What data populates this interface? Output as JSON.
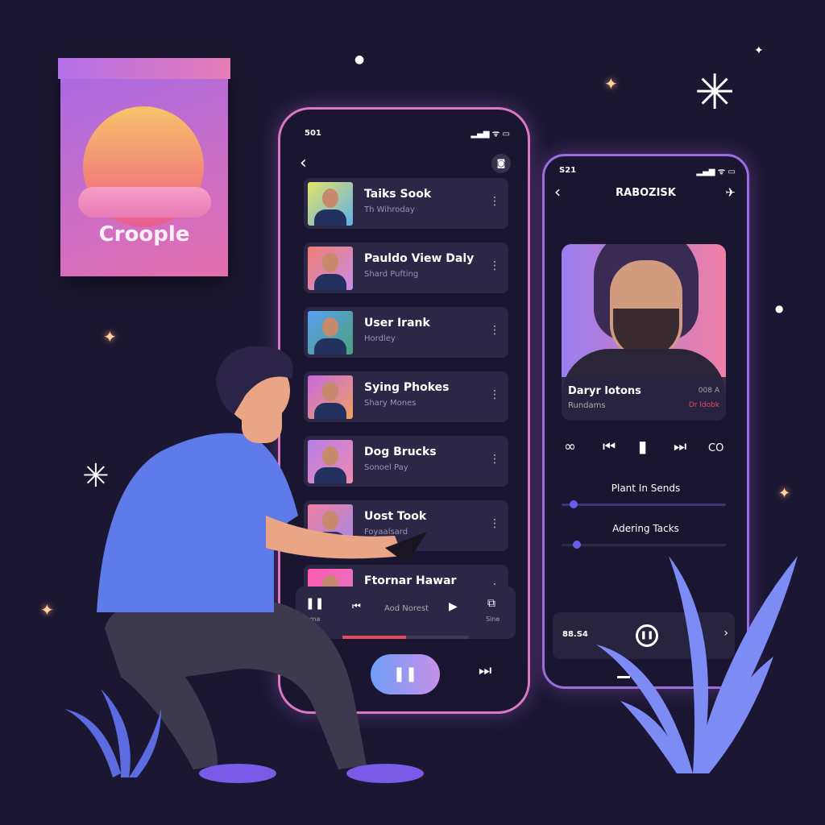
{
  "brand_card": {
    "label": "Croople"
  },
  "phone_list": {
    "status_time": "501",
    "rows": [
      {
        "title": "Taiks Sook",
        "subtitle": "Th Wihroday"
      },
      {
        "title": "Pauldo View Daly",
        "subtitle": "Shard Pufting"
      },
      {
        "title": "User Irank",
        "subtitle": "Hordley"
      },
      {
        "title": "Sying Phokes",
        "subtitle": "Shary Mones"
      },
      {
        "title": "Dog Brucks",
        "subtitle": "Sonoel Pay"
      },
      {
        "title": "Uost Took",
        "subtitle": "Foyaalsard"
      },
      {
        "title": "Ftornar Hawar",
        "subtitle": ""
      }
    ],
    "mini_player": {
      "left_label": "Fhma",
      "track": "Aod Norest",
      "right_label": "Sine",
      "progress": 0.5
    }
  },
  "phone_player": {
    "status_time": "S21",
    "title": "RABOZISK",
    "artist": "Daryr lotons",
    "album": "Rundams",
    "meta_right": "008 A",
    "meta_link": "Dr ldobk",
    "left_ctrl": "∞",
    "right_ctrl": "CO",
    "slider1_label": "Plant In Sends",
    "slider1_value": 0.05,
    "slider2_label": "Adering Tacks",
    "slider2_value": 0.07,
    "bottom_time": "88.S4"
  },
  "colors": {
    "background": "#1b1733",
    "accent": "#6a5cf0",
    "progress": "#e84a5f"
  }
}
